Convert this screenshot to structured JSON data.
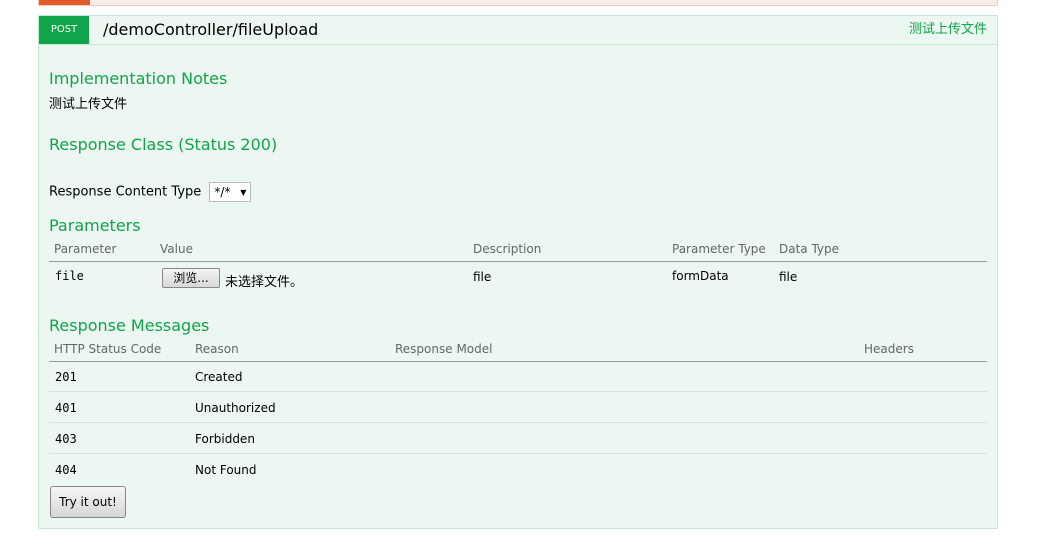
{
  "operation": {
    "method": "POST",
    "path": "/demoController/fileUpload",
    "summary": "测试上传文件"
  },
  "implementation_notes": {
    "heading": "Implementation Notes",
    "text": "测试上传文件"
  },
  "response_class": {
    "heading": "Response Class (Status 200)"
  },
  "content_type": {
    "label": "Response Content Type",
    "selected": "*/*"
  },
  "parameters": {
    "heading": "Parameters",
    "columns": [
      "Parameter",
      "Value",
      "Description",
      "Parameter Type",
      "Data Type"
    ],
    "rows": [
      {
        "parameter": "file",
        "browse_label": "浏览...",
        "no_file_text": "未选择文件。",
        "description": "file",
        "param_type": "formData",
        "data_type": "file"
      }
    ]
  },
  "response_messages": {
    "heading": "Response Messages",
    "columns": [
      "HTTP Status Code",
      "Reason",
      "Response Model",
      "Headers"
    ],
    "rows": [
      {
        "code": "201",
        "reason": "Created"
      },
      {
        "code": "401",
        "reason": "Unauthorized"
      },
      {
        "code": "403",
        "reason": "Forbidden"
      },
      {
        "code": "404",
        "reason": "Not Found"
      }
    ]
  },
  "try_button": "Try it out!",
  "colors": {
    "accent": "#10a54a",
    "panel_bg": "#ebf7f0",
    "panel_border": "#c3e8d1",
    "prev_accent": "#e35b2a"
  }
}
